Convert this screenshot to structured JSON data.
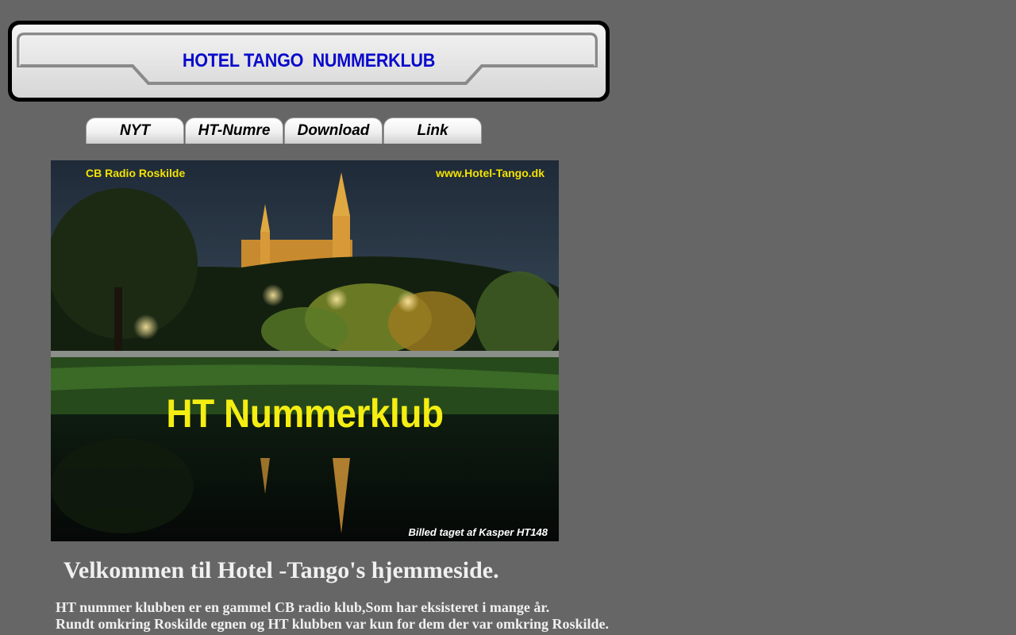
{
  "banner": {
    "title": "HOTEL TANGO  NUMMERKLUB"
  },
  "nav": {
    "items": [
      {
        "label": "NYT"
      },
      {
        "label": "HT-Numre"
      },
      {
        "label": "Download"
      },
      {
        "label": "Link"
      }
    ]
  },
  "hero": {
    "top_left": "CB Radio Roskilde",
    "top_right": "www.Hotel-Tango.dk",
    "main_title": "HT Nummerklub",
    "credit": "Billed taget af  Kasper HT148"
  },
  "content": {
    "welcome": "Velkommen til Hotel -Tango's hjemmeside.",
    "intro_lines": [
      "HT nummer klubben er en gammel CB radio klub,Som har eksisteret i mange år.",
      "Rundt omkring Roskilde egnen og HT klubben var kun for dem der var omkring Roskilde."
    ]
  },
  "colors": {
    "page_background": "#666666",
    "banner_title": "#0a0acc",
    "hero_title": "#f5ee12"
  }
}
